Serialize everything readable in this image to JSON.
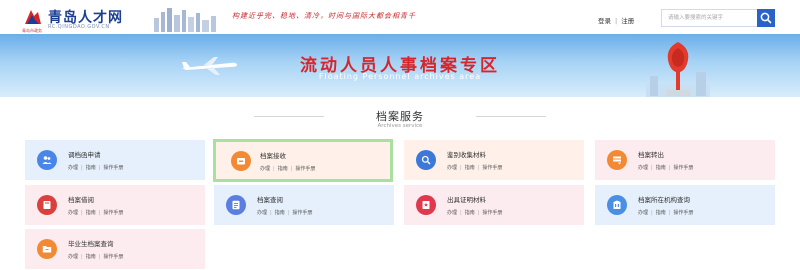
{
  "header": {
    "logo_name": "青岛人才网",
    "logo_sub": "RC.QINGDAO.GOV.CN",
    "logo_tag": "青岛市政务",
    "slogan": "构建近乎完、稳地、清冷，时间与国际大都会相青千",
    "login_label": "登录",
    "register_label": "注册",
    "search_placeholder": "请输入要搜索的关键字"
  },
  "banner": {
    "title": "流动人员人事档案专区",
    "subtitle": "Floating Personnel archives  area"
  },
  "section": {
    "title": "档案服务",
    "subtitle": "Archives service"
  },
  "link_labels": {
    "handle": "办理",
    "guide": "指南",
    "manual": "操作手册"
  },
  "services": [
    {
      "name": "调档函申请",
      "icon": "people-icon",
      "color": "#4a86e8"
    },
    {
      "name": "档案接收",
      "icon": "inbox-icon",
      "color": "#f28a35"
    },
    {
      "name": "鉴别收集材料",
      "icon": "search-icon",
      "color": "#3b78d8"
    },
    {
      "name": "档案转出",
      "icon": "transfer-icon",
      "color": "#f28a35"
    },
    {
      "name": "档案借阅",
      "icon": "book-icon",
      "color": "#d9413f"
    },
    {
      "name": "档案查阅",
      "icon": "document-icon",
      "color": "#5a7fe0"
    },
    {
      "name": "出具证明材料",
      "icon": "certificate-icon",
      "color": "#e0384d"
    },
    {
      "name": "档案所在机构查询",
      "icon": "building-icon",
      "color": "#4a8fe4"
    },
    {
      "name": "毕业生档案查询",
      "icon": "folder-icon",
      "color": "#f28a35"
    }
  ],
  "colors": {
    "brand": "#1c3f94",
    "accent": "#2a63c8",
    "banner_title": "#d7262b",
    "selected_border": "#a8e0a0"
  }
}
